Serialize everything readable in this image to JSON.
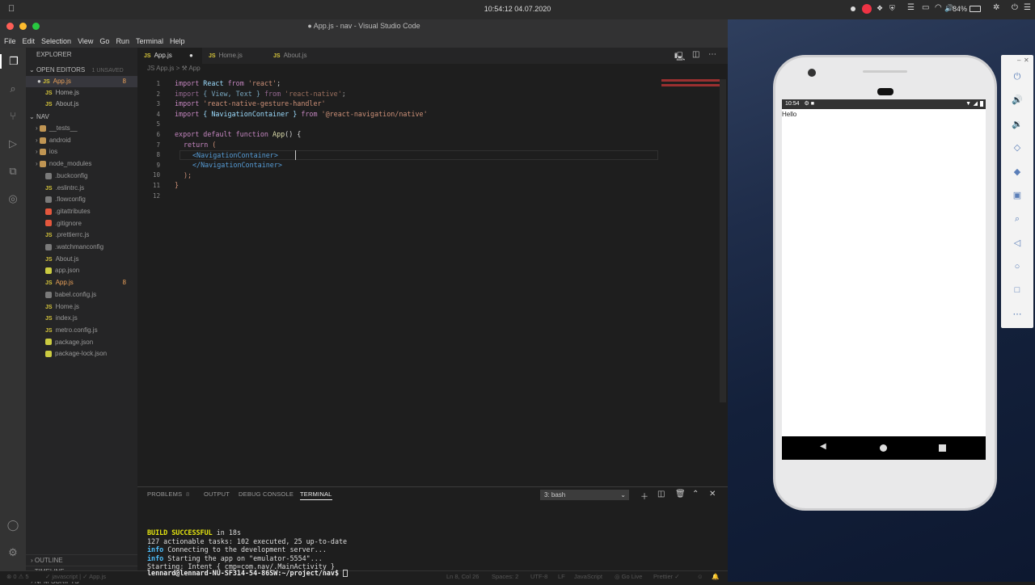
{
  "mac_menubar": {
    "clock": "10:54:12  04.07.2020",
    "battery": "84%"
  },
  "vscode": {
    "window_title": "● App.js - nav - Visual Studio Code",
    "menu": [
      "File",
      "Edit",
      "Selection",
      "View",
      "Go",
      "Run",
      "Terminal",
      "Help"
    ],
    "explorer": {
      "header": "EXPLORER",
      "open_editors_label": "OPEN EDITORS",
      "unsaved_label": "1 UNSAVED",
      "open_editors": [
        {
          "name": "App.js",
          "badge": "8"
        },
        {
          "name": "Home.js",
          "badge": ""
        },
        {
          "name": "About.js",
          "badge": ""
        }
      ],
      "project_label": "NAV",
      "files": [
        {
          "name": "__tests__",
          "type": "folder"
        },
        {
          "name": "android",
          "type": "folder"
        },
        {
          "name": "ios",
          "type": "folder"
        },
        {
          "name": "node_modules",
          "type": "folder"
        },
        {
          "name": ".buckconfig",
          "type": "file"
        },
        {
          "name": ".eslintrc.js",
          "type": "js"
        },
        {
          "name": ".flowconfig",
          "type": "file"
        },
        {
          "name": ".gitattributes",
          "type": "git"
        },
        {
          "name": ".gitignore",
          "type": "git"
        },
        {
          "name": ".prettierrc.js",
          "type": "js"
        },
        {
          "name": ".watchmanconfig",
          "type": "file"
        },
        {
          "name": "About.js",
          "type": "js"
        },
        {
          "name": "app.json",
          "type": "json"
        },
        {
          "name": "App.js",
          "type": "js",
          "badge": "8"
        },
        {
          "name": "babel.config.js",
          "type": "file"
        },
        {
          "name": "Home.js",
          "type": "js"
        },
        {
          "name": "index.js",
          "type": "js"
        },
        {
          "name": "metro.config.js",
          "type": "js"
        },
        {
          "name": "package.json",
          "type": "json"
        },
        {
          "name": "package-lock.json",
          "type": "json"
        }
      ],
      "bottom_sections": [
        "OUTLINE",
        "TIMELINE",
        "NPM SCRIPTS"
      ]
    },
    "tabs": [
      {
        "label": "App.js",
        "active": true,
        "dirty": true
      },
      {
        "label": "Home.js",
        "active": false
      },
      {
        "label": "About.js",
        "active": false
      }
    ],
    "breadcrumb": "JS App.js > ⚒ App",
    "code_lines": [
      "1",
      "2",
      "3",
      "4",
      "5",
      "6",
      "7",
      "8",
      "9",
      "10",
      "11",
      "12"
    ],
    "code": {
      "l1": {
        "kw": "import",
        "id": " React ",
        "kw2": "from",
        "st": " 'react'",
        "p": ";"
      },
      "l2": {
        "kw": "import",
        "id": " { View, Text } ",
        "kw2": "from",
        "st": " 'react-native'",
        "p": ";"
      },
      "l3": {
        "kw": "import",
        "st": " 'react-native-gesture-handler'"
      },
      "l4": {
        "kw": "import",
        "id": " { NavigationContainer } ",
        "kw2": "from",
        "st": " '@react-navigation/native'"
      },
      "l6": {
        "kw": "export default function",
        "fn": " App",
        "p": "() {"
      },
      "l7": {
        "kw": "return",
        "p": " ("
      },
      "l8": {
        "tag": "<NavigationContainer>"
      },
      "l9": {
        "tag": "</NavigationContainer>"
      },
      "l10": {
        "p": ");"
      },
      "l11": {
        "p": "}"
      }
    },
    "panel": {
      "tabs": [
        "PROBLEMS",
        "OUTPUT",
        "DEBUG CONSOLE",
        "TERMINAL"
      ],
      "problems_count": "8",
      "terminal_select": "3: bash",
      "terminal_lines": [
        {
          "a": "BUILD SUCCESSFUL",
          "b": " in 18s"
        },
        {
          "a": "",
          "b": "127 actionable tasks: 102 executed, 25 up-to-date"
        },
        {
          "a": "info",
          "b": " Connecting to the development server..."
        },
        {
          "a": "info",
          "b": " Starting the app on \"emulator-5554\"..."
        },
        {
          "a": "",
          "b": "Starting: Intent { cmp=com.nav/.MainActivity }"
        },
        {
          "a": "lennard@lennard-NU-SF314-54-86SW",
          "b": ":~/project/nav$ "
        }
      ]
    },
    "status": {
      "errors": "⊗ 0 ⚠ 5",
      "lang_path": "✓ javascript | ✓ App.js",
      "position": "Ln 8, Col 26",
      "spaces": "Spaces: 2",
      "encoding": "UTF-8",
      "eol": "LF",
      "language": "JavaScript",
      "golive": "◎ Go Live",
      "prettier": "Prettier ✓"
    }
  },
  "emulator": {
    "status_time": "10:54",
    "app_text": "Hello"
  }
}
